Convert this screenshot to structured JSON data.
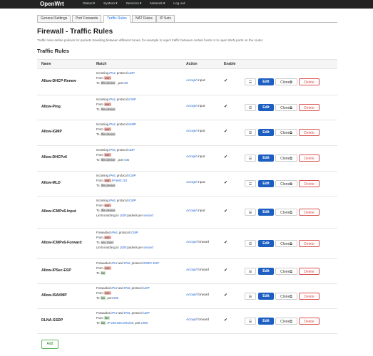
{
  "brand": "OpenWrt",
  "menu": [
    "Status",
    "System",
    "Services",
    "Network",
    "Log out"
  ],
  "tabs": [
    "General Settings",
    "Port Forwards",
    "Traffic Rules",
    "NAT Rules",
    "IP Sets"
  ],
  "title": "Firewall - Traffic Rules",
  "description": "Traffic rules define policies for packets travelling between different zones, for example to reject traffic between certain hosts or to open WAN ports on the router.",
  "subtitle": "Traffic Rules",
  "columns": [
    "Name",
    "Match",
    "Action",
    "Enable"
  ],
  "buttons": {
    "handle": "☰",
    "edit": "Edit",
    "clone": "Clone⧉",
    "delete": "Delete",
    "add": "Add"
  },
  "rules": [
    {
      "name": "Allow-DHCP-Renew",
      "action_link": "Accept",
      "action_rest": " input",
      "enabled": "✔",
      "lines": [
        [
          {
            "t": "Incoming "
          },
          {
            "t": "IPv4",
            "c": "link"
          },
          {
            "t": ", protocol "
          },
          {
            "t": "UDP",
            "c": "link"
          }
        ],
        [
          {
            "t": "From "
          },
          {
            "t": "wan",
            "c": "tag-wan"
          }
        ],
        [
          {
            "t": "To "
          },
          {
            "t": "this device",
            "c": "tag-dev"
          },
          {
            "t": " , port "
          },
          {
            "t": "68",
            "c": "link"
          }
        ]
      ]
    },
    {
      "name": "Allow-Ping",
      "action_link": "Accept",
      "action_rest": " input",
      "enabled": "✔",
      "lines": [
        [
          {
            "t": "Incoming "
          },
          {
            "t": "IPv4",
            "c": "link"
          },
          {
            "t": ", protocol "
          },
          {
            "t": "ICMP",
            "c": "link"
          }
        ],
        [
          {
            "t": "From "
          },
          {
            "t": "wan",
            "c": "tag-wan"
          }
        ],
        [
          {
            "t": "To "
          },
          {
            "t": "this device",
            "c": "tag-dev"
          }
        ]
      ]
    },
    {
      "name": "Allow-IGMP",
      "action_link": "Accept",
      "action_rest": " input",
      "enabled": "✔",
      "lines": [
        [
          {
            "t": "Incoming "
          },
          {
            "t": "IPv4",
            "c": "link"
          },
          {
            "t": ", protocol "
          },
          {
            "t": "IGMP",
            "c": "link"
          }
        ],
        [
          {
            "t": "From "
          },
          {
            "t": "wan",
            "c": "tag-wan"
          }
        ],
        [
          {
            "t": "To "
          },
          {
            "t": "this device",
            "c": "tag-dev"
          }
        ]
      ]
    },
    {
      "name": "Allow-DHCPv6",
      "action_link": "Accept",
      "action_rest": " input",
      "enabled": "✔",
      "lines": [
        [
          {
            "t": "Incoming "
          },
          {
            "t": "IPv6",
            "c": "link"
          },
          {
            "t": ", protocol "
          },
          {
            "t": "UDP",
            "c": "link"
          }
        ],
        [
          {
            "t": "From "
          },
          {
            "t": "wan",
            "c": "tag-wan"
          }
        ],
        [
          {
            "t": "To "
          },
          {
            "t": "this device",
            "c": "tag-dev"
          },
          {
            "t": " , port "
          },
          {
            "t": "546",
            "c": "link"
          }
        ]
      ]
    },
    {
      "name": "Allow-MLD",
      "action_link": "Accept",
      "action_rest": " input",
      "enabled": "✔",
      "lines": [
        [
          {
            "t": "Incoming "
          },
          {
            "t": "IPv6",
            "c": "link"
          },
          {
            "t": ", protocol "
          },
          {
            "t": "ICMP",
            "c": "link"
          }
        ],
        [
          {
            "t": "From "
          },
          {
            "t": "wan",
            "c": "tag-wan"
          },
          {
            "t": " "
          },
          {
            "t": "IP fe80::/10",
            "c": "link"
          }
        ],
        [
          {
            "t": "To "
          },
          {
            "t": "this device",
            "c": "tag-dev"
          }
        ]
      ]
    },
    {
      "name": "Allow-ICMPv6-Input",
      "action_link": "Accept",
      "action_rest": " input",
      "enabled": "✔",
      "lines": [
        [
          {
            "t": "Incoming "
          },
          {
            "t": "IPv6",
            "c": "link"
          },
          {
            "t": ", protocol "
          },
          {
            "t": "ICMP",
            "c": "link"
          }
        ],
        [
          {
            "t": "From "
          },
          {
            "t": "wan",
            "c": "tag-wan"
          }
        ],
        [
          {
            "t": "To "
          },
          {
            "t": "this device",
            "c": "tag-dev"
          }
        ],
        [
          {
            "t": "Limit matching to "
          },
          {
            "t": "1000",
            "c": "link"
          },
          {
            "t": " packets per "
          },
          {
            "t": "second",
            "c": "link"
          }
        ]
      ]
    },
    {
      "name": "Allow-ICMPv6-Forward",
      "action_link": "Accept",
      "action_rest": " forward",
      "enabled": "✔",
      "lines": [
        [
          {
            "t": "Forwarded "
          },
          {
            "t": "IPv6",
            "c": "link"
          },
          {
            "t": ", protocol "
          },
          {
            "t": "ICMP",
            "c": "link"
          }
        ],
        [
          {
            "t": "From "
          },
          {
            "t": "wan",
            "c": "tag-wan"
          }
        ],
        [
          {
            "t": "To "
          },
          {
            "t": "any zone",
            "c": "tag-dev"
          }
        ],
        [
          {
            "t": "Limit matching to "
          },
          {
            "t": "1000",
            "c": "link"
          },
          {
            "t": " packets per "
          },
          {
            "t": "second",
            "c": "link"
          }
        ]
      ]
    },
    {
      "name": "Allow-IPSec-ESP",
      "action_link": "Accept",
      "action_rest": " forward",
      "enabled": "✔",
      "lines": [
        [
          {
            "t": "Forwarded "
          },
          {
            "t": "IPv4",
            "c": "link"
          },
          {
            "t": " and "
          },
          {
            "t": "IPv6",
            "c": "link"
          },
          {
            "t": ", protocol "
          },
          {
            "t": "IPSEC-ESP",
            "c": "link"
          }
        ],
        [
          {
            "t": "From "
          },
          {
            "t": "wan",
            "c": "tag-wan"
          }
        ],
        [
          {
            "t": "To "
          },
          {
            "t": "lan",
            "c": "tag-lan"
          }
        ]
      ]
    },
    {
      "name": "Allow-ISAKMP",
      "action_link": "Accept",
      "action_rest": " forward",
      "enabled": "✔",
      "lines": [
        [
          {
            "t": "Forwarded "
          },
          {
            "t": "IPv4",
            "c": "link"
          },
          {
            "t": " and "
          },
          {
            "t": "IPv6",
            "c": "link"
          },
          {
            "t": ", protocol "
          },
          {
            "t": "UDP",
            "c": "link"
          }
        ],
        [
          {
            "t": "From "
          },
          {
            "t": "wan",
            "c": "tag-wan"
          }
        ],
        [
          {
            "t": "To "
          },
          {
            "t": "lan",
            "c": "tag-lan"
          },
          {
            "t": ", port "
          },
          {
            "t": "500",
            "c": "link"
          }
        ]
      ]
    },
    {
      "name": "DLNA-SSDP",
      "action_link": "Accept",
      "action_rest": " forward",
      "enabled": "✔",
      "lines": [
        [
          {
            "t": "Forwarded "
          },
          {
            "t": "IPv4",
            "c": "link"
          },
          {
            "t": " and "
          },
          {
            "t": "IPv6",
            "c": "link"
          },
          {
            "t": ", protocol "
          },
          {
            "t": "UDP",
            "c": "link"
          }
        ],
        [
          {
            "t": "From "
          },
          {
            "t": "lan",
            "c": "tag-lan"
          }
        ],
        [
          {
            "t": "To "
          },
          {
            "t": "lan",
            "c": "tag-lan"
          },
          {
            "t": ", "
          },
          {
            "t": "IP 239.255.255.250",
            "c": "link"
          },
          {
            "t": ", port "
          },
          {
            "t": "1900",
            "c": "link"
          }
        ]
      ]
    }
  ]
}
